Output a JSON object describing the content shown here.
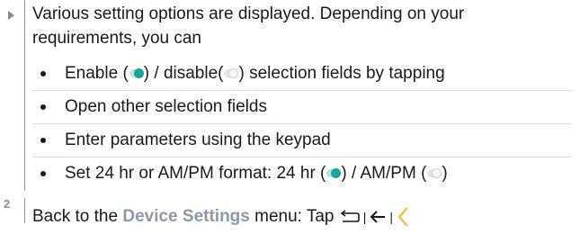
{
  "step1": {
    "intro": "Various setting options are displayed. Depending on your requirements, you can",
    "bullets": [
      {
        "pre": "Enable (",
        "mid": ") / disable(",
        "post": ") selection fields by tapping"
      },
      {
        "text": "Open other selection fields"
      },
      {
        "text": "Enter parameters using the keypad"
      },
      {
        "pre": "Set 24 hr or AM/PM format: 24 hr (",
        "mid": ") / AM/PM (",
        "post": ")"
      }
    ]
  },
  "step2": {
    "number": "2",
    "text_before": "Back to the ",
    "menu_name": "Device Settings",
    "text_after": " menu: Tap ",
    "separator": "|",
    "icons": [
      "return-icon",
      "back-arrow-icon",
      "chevron-left-icon"
    ]
  },
  "colors": {
    "toggle_on": "#1aa39a",
    "menu_name": "#8c9aa8",
    "chevron": "#f0c040"
  }
}
